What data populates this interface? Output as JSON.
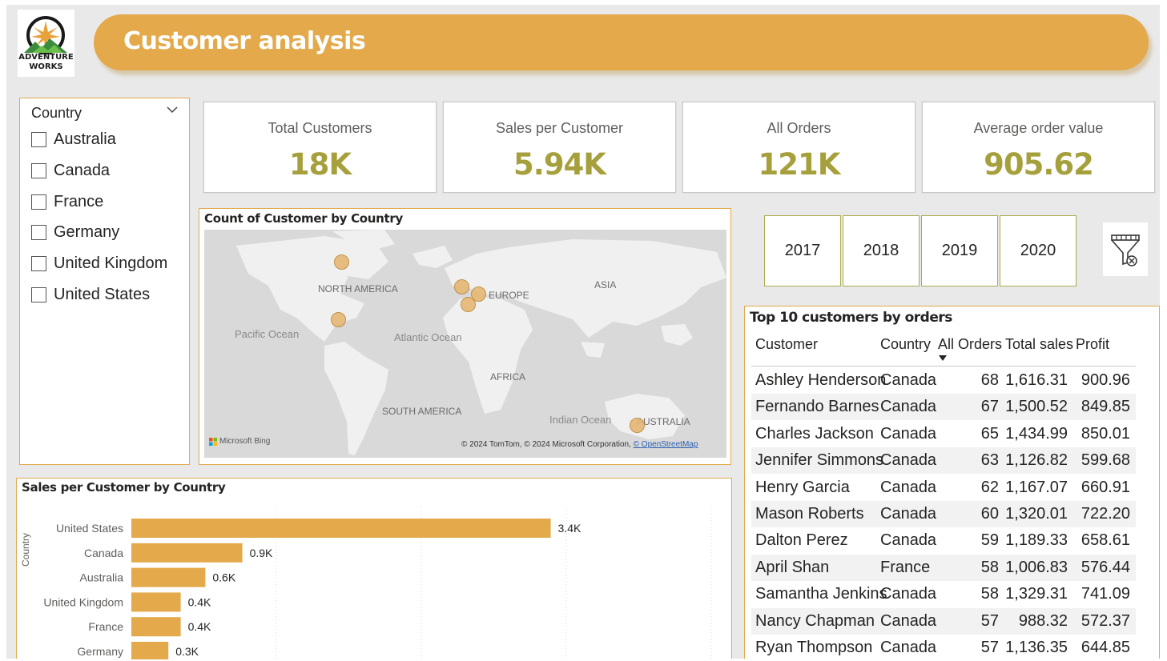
{
  "header": {
    "title": "Customer analysis",
    "logo_text_line1": "ADVENTURE",
    "logo_text_line2": "WORKS"
  },
  "country_slicer": {
    "title": "Country",
    "items": [
      "Australia",
      "Canada",
      "France",
      "Germany",
      "United Kingdom",
      "United States"
    ]
  },
  "kpis": [
    {
      "label": "Total Customers",
      "value": "18K"
    },
    {
      "label": "Sales per Customer",
      "value": "5.94K"
    },
    {
      "label": "All Orders",
      "value": "121K"
    },
    {
      "label": "Average order value",
      "value": "905.62"
    }
  ],
  "map": {
    "title": "Count of Customer by Country",
    "labels": {
      "north_america": "NORTH AMERICA",
      "europe": "EUROPE",
      "asia": "ASIA",
      "africa": "AFRICA",
      "south_america": "SOUTH AMERICA",
      "australia": "AUSTRALIA",
      "pacific": "Pacific Ocean",
      "atlantic": "Atlantic Ocean",
      "indian": "Indian Ocean"
    },
    "bing": "Microsoft Bing",
    "attribution": "© 2024 TomTom, © 2024 Microsoft Corporation,",
    "attribution_link": "© OpenStreetMap"
  },
  "years": [
    "2017",
    "2018",
    "2019",
    "2020"
  ],
  "top_customers": {
    "title": "Top 10 customers by orders",
    "columns": [
      "Customer",
      "Country",
      "All Orders",
      "Total sales",
      "Profit"
    ],
    "rows": [
      {
        "customer": "Ashley Henderson",
        "country": "Canada",
        "orders": "68",
        "sales": "1,616.31",
        "profit": "900.96"
      },
      {
        "customer": "Fernando Barnes",
        "country": "Canada",
        "orders": "67",
        "sales": "1,500.52",
        "profit": "849.85"
      },
      {
        "customer": "Charles Jackson",
        "country": "Canada",
        "orders": "65",
        "sales": "1,434.99",
        "profit": "850.01"
      },
      {
        "customer": "Jennifer Simmons",
        "country": "Canada",
        "orders": "63",
        "sales": "1,126.82",
        "profit": "599.68"
      },
      {
        "customer": "Henry Garcia",
        "country": "Canada",
        "orders": "62",
        "sales": "1,167.07",
        "profit": "660.91"
      },
      {
        "customer": "Mason Roberts",
        "country": "Canada",
        "orders": "60",
        "sales": "1,320.01",
        "profit": "722.20"
      },
      {
        "customer": "Dalton Perez",
        "country": "Canada",
        "orders": "59",
        "sales": "1,189.33",
        "profit": "658.61"
      },
      {
        "customer": "April Shan",
        "country": "France",
        "orders": "58",
        "sales": "1,006.83",
        "profit": "576.44"
      },
      {
        "customer": "Samantha Jenkins",
        "country": "Canada",
        "orders": "58",
        "sales": "1,329.31",
        "profit": "741.09"
      },
      {
        "customer": "Nancy Chapman",
        "country": "Canada",
        "orders": "57",
        "sales": "988.32",
        "profit": "572.37"
      },
      {
        "customer": "Ryan Thompson",
        "country": "Canada",
        "orders": "57",
        "sales": "1,136.35",
        "profit": "644.85"
      }
    ]
  },
  "chart_data": {
    "type": "bar",
    "orientation": "horizontal",
    "title": "Sales per Customer by Country",
    "ylabel": "Country",
    "categories": [
      "United States",
      "Canada",
      "Australia",
      "United Kingdom",
      "France",
      "Germany"
    ],
    "values": [
      3400,
      900,
      600,
      400,
      400,
      300
    ],
    "data_labels": [
      "3.4K",
      "0.9K",
      "0.6K",
      "0.4K",
      "0.4K",
      "0.3K"
    ],
    "xlim": [
      0,
      4000
    ],
    "grid": true,
    "bar_color": "#e3a94b"
  },
  "colors": {
    "accent": "#e3a94b",
    "kpi_value": "#a6a03c",
    "year_border": "#a9ad4f"
  }
}
